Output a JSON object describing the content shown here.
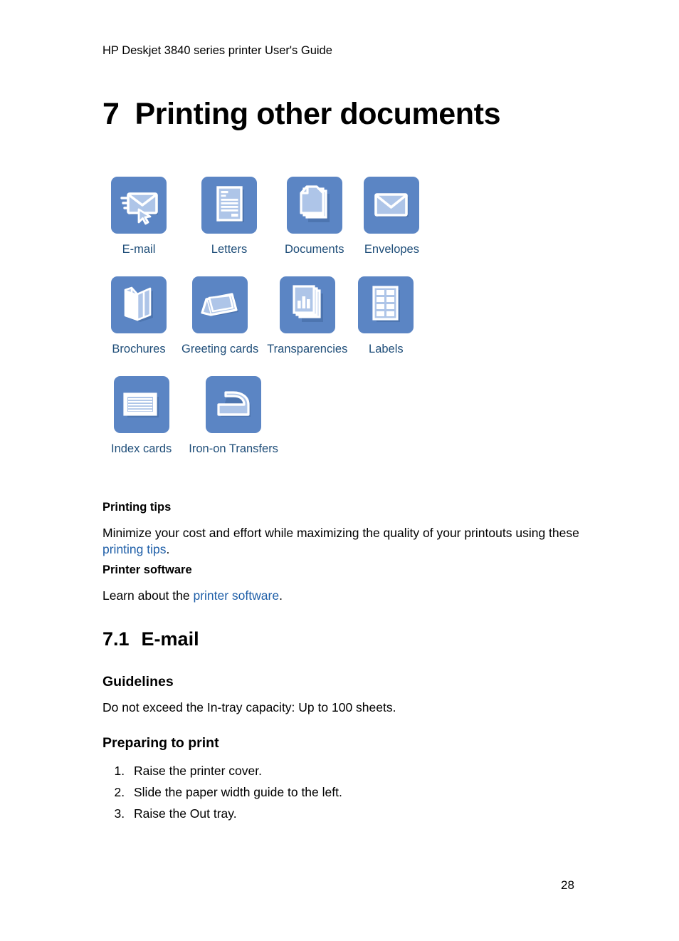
{
  "header": {
    "running_title": "HP Deskjet 3840 series printer User's Guide"
  },
  "chapter": {
    "number": "7",
    "title": "Printing other documents"
  },
  "icon_grid": {
    "rows": [
      [
        {
          "icon": "email-icon",
          "label": "E-mail"
        },
        {
          "icon": "letters-icon",
          "label": "Letters"
        },
        {
          "icon": "documents-icon",
          "label": "Documents"
        },
        {
          "icon": "envelopes-icon",
          "label": "Envelopes"
        }
      ],
      [
        {
          "icon": "brochures-icon",
          "label": "Brochures"
        },
        {
          "icon": "greeting-cards-icon",
          "label": "Greeting cards"
        },
        {
          "icon": "transparencies-icon",
          "label": "Transparencies"
        },
        {
          "icon": "labels-icon",
          "label": "Labels"
        }
      ],
      [
        {
          "icon": "index-cards-icon",
          "label": "Index cards"
        },
        {
          "icon": "iron-on-transfers-icon",
          "label": "Iron-on Transfers"
        }
      ]
    ]
  },
  "printing_tips": {
    "heading": "Printing tips",
    "text_before": "Minimize your cost and effort while maximizing the quality of your printouts using these ",
    "link": "printing tips",
    "text_after": "."
  },
  "printer_software": {
    "heading": "Printer software",
    "text_before": "Learn about the ",
    "link": "printer software",
    "text_after": "."
  },
  "section": {
    "number": "7.1",
    "title": "E-mail"
  },
  "guidelines": {
    "heading": "Guidelines",
    "text": "Do not exceed the In-tray capacity: Up to 100 sheets."
  },
  "preparing": {
    "heading": "Preparing to print",
    "steps": [
      "Raise the printer cover.",
      "Slide the paper width guide to the left.",
      "Raise the Out tray."
    ]
  },
  "footer": {
    "page_number": "28"
  },
  "colors": {
    "tile_blue": "#5b85c4",
    "icon_fill": "#aec5e8",
    "icon_stroke": "#ffffff",
    "link_blue": "#1f5fa8",
    "label_blue": "#1f4e79"
  }
}
